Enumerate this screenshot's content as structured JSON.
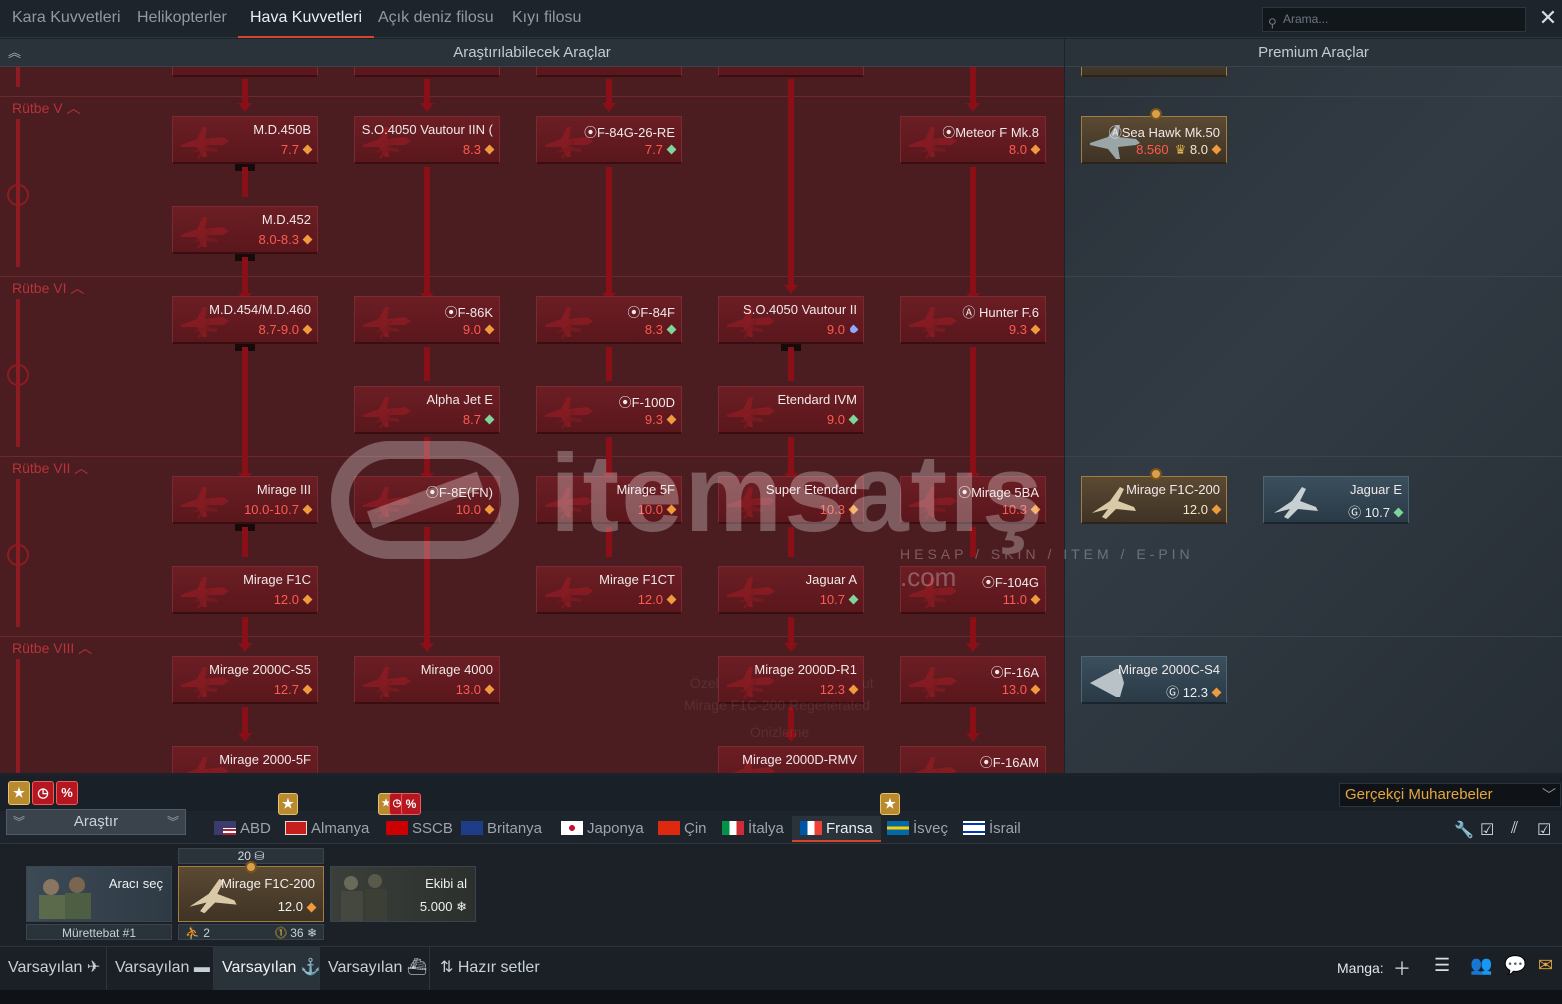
{
  "top_tabs": [
    "Kara Kuvvetleri",
    "Helikopterler",
    "Hava Kuvvetleri",
    "Açık deniz filosu",
    "Kıyı filosu"
  ],
  "search": {
    "placeholder": "Arama..."
  },
  "headers": {
    "research": "Araştırılabilecek Araçlar",
    "premium": "Premium Araçlar"
  },
  "ranks": [
    "Rütbe V",
    "Rütbe VI",
    "Rütbe VII",
    "Rütbe VIII"
  ],
  "vehicles": [
    {
      "name": "M.D.450B",
      "br": "7.7",
      "dia": "orange"
    },
    {
      "name": "S.O.4050 Vautour IIN (",
      "br": "8.3",
      "dia": "orange"
    },
    {
      "name": "⦿F-84G-26-RE",
      "br": "7.7",
      "dia": "green"
    },
    {
      "name": "⦿Meteor F Mk.8",
      "br": "8.0",
      "dia": "orange"
    },
    {
      "name": "M.D.452",
      "br": "8.0-8.3",
      "dia": "orange"
    },
    {
      "name": "M.D.454/M.D.460",
      "br": "8.7-9.0",
      "dia": "orange"
    },
    {
      "name": "⦿F-86K",
      "br": "9.0",
      "dia": "orange"
    },
    {
      "name": "⦿F-84F",
      "br": "8.3",
      "dia": "green"
    },
    {
      "name": "S.O.4050 Vautour II",
      "br": "9.0",
      "dia": "blue"
    },
    {
      "name": "Ⓐ Hunter F.6",
      "br": "9.3",
      "dia": "orange"
    },
    {
      "name": "Alpha Jet E",
      "br": "8.7",
      "dia": "green"
    },
    {
      "name": "⦿F-100D",
      "br": "9.3",
      "dia": "orange"
    },
    {
      "name": "Etendard IVM",
      "br": "9.0",
      "dia": "green"
    },
    {
      "name": "Mirage III",
      "br": "10.0-10.7",
      "dia": "orange"
    },
    {
      "name": "⦿F-8E(FN)",
      "br": "10.0",
      "dia": "orange"
    },
    {
      "name": "Mirage 5F",
      "br": "10.0",
      "dia": "orange"
    },
    {
      "name": "Super Etendard",
      "br": "10.3",
      "dia": "orange"
    },
    {
      "name": "⦿Mirage 5BA",
      "br": "10.3",
      "dia": "orange"
    },
    {
      "name": "Mirage F1C",
      "br": "12.0",
      "dia": "orange"
    },
    {
      "name": "Mirage F1CT",
      "br": "12.0",
      "dia": "orange"
    },
    {
      "name": "Jaguar A",
      "br": "10.7",
      "dia": "green"
    },
    {
      "name": "⦿F-104G",
      "br": "11.0",
      "dia": "orange"
    },
    {
      "name": "Mirage 2000C-S5",
      "br": "12.7",
      "dia": "orange"
    },
    {
      "name": "Mirage 4000",
      "br": "13.0",
      "dia": "orange"
    },
    {
      "name": "Mirage 2000D-R1",
      "br": "12.3",
      "dia": "orange"
    },
    {
      "name": "⦿F-16A",
      "br": "13.0",
      "dia": "orange"
    },
    {
      "name": "Mirage 2000-5F",
      "br": "",
      "dia": ""
    },
    {
      "name": "Mirage 2000D-RMV",
      "br": "",
      "dia": ""
    },
    {
      "name": "⦿F-16AM",
      "br": "",
      "dia": ""
    }
  ],
  "premium_vehicles": [
    {
      "name": "ⒶSea Hawk Mk.50",
      "price": "8.560",
      "br": "8.0",
      "dia": "orange"
    },
    {
      "name": "Mirage F1C-200",
      "br": "12.0",
      "dia": "orange"
    },
    {
      "name": "Jaguar E",
      "br": "Ⓖ 10.7",
      "dia": "green"
    },
    {
      "name": "Mirage 2000C-S4",
      "br": "Ⓖ 12.3",
      "dia": "orange"
    }
  ],
  "faint_overlay": [
    "Özel",
    "ut",
    "Mirage F1C-200 Regenerated",
    "Önizleme"
  ],
  "watermark": {
    "text": "itemsatış",
    "sub": "HESAP / SKIN / ITEM / E-PIN",
    "com": ".com"
  },
  "mode": "Gerçekçi Muharebeler",
  "research_button": "Araştır",
  "nations": [
    "ABD",
    "Almanya",
    "SSCB",
    "Britanya",
    "Japonya",
    "Çin",
    "İtalya",
    "Fransa",
    "İsveç",
    "İsrail"
  ],
  "active_nation": "Fransa",
  "slots": {
    "crew_label": "Aracı seç",
    "crew_name": "Mürettebat #1",
    "vehicle_name": "Mirage F1C-200",
    "vehicle_br": "12.0",
    "vehicle_top": "20",
    "vehicle_crew": "2",
    "vehicle_repair": "36",
    "buy_label": "Ekibi al",
    "buy_price": "5.000"
  },
  "presets": [
    "Varsayılan",
    "Varsayılan",
    "Varsayılan",
    "Varsayılan"
  ],
  "presets_button": "Hazır setler",
  "squad_label": "Manga:",
  "colors": {
    "accent": "#d7442c",
    "research_bg": "#4b1c20",
    "br_red": "#ff5a4f",
    "mode_gold": "#e5a640"
  }
}
